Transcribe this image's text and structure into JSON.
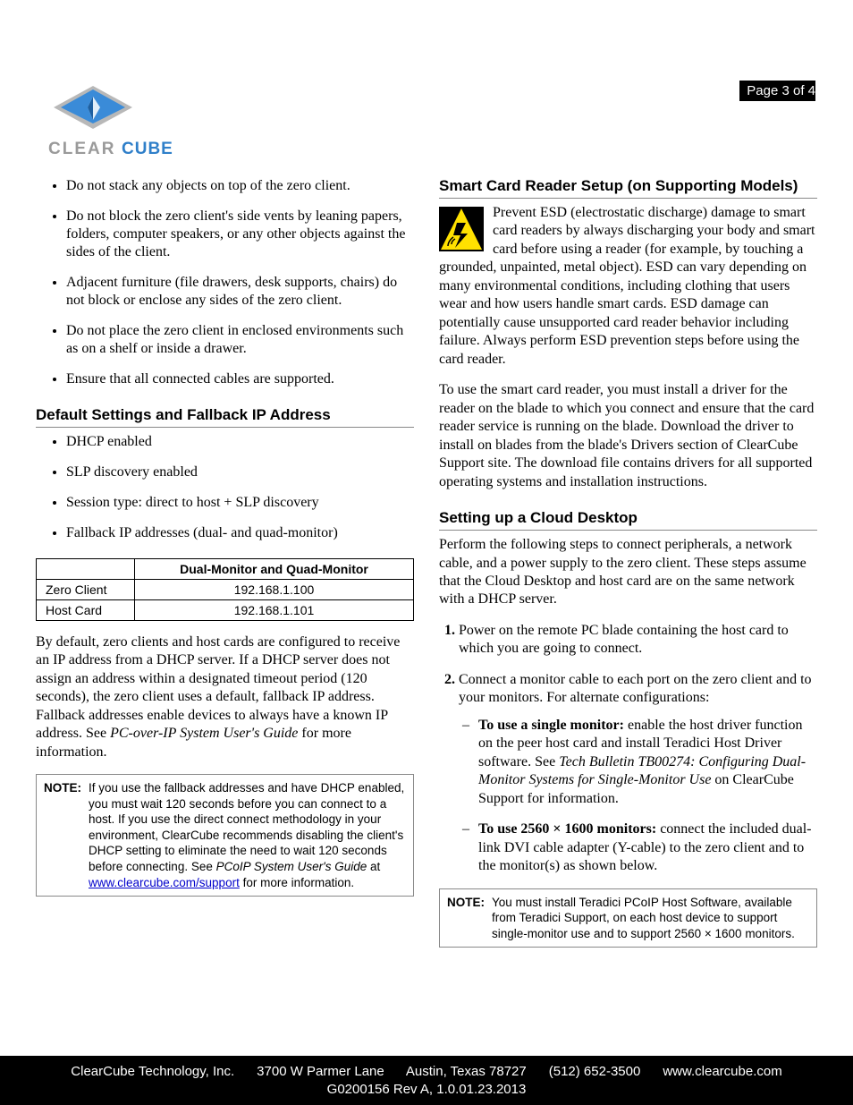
{
  "page_number": "Page 3 of 4",
  "logo": {
    "text1": "CLEAR",
    "text2": "CUBE"
  },
  "left": {
    "bullets": [
      "Do not stack any objects on top of the zero client.",
      "Do not block the zero client's side vents by leaning papers, folders, computer speakers, or any other objects against the sides of the client.",
      "Adjacent furniture (file drawers, desk supports, chairs) do not block or enclose any sides of the zero client.",
      "Do not place the zero client in enclosed environments such as on a shelf or inside a drawer.",
      "Ensure that all connected cables are supported."
    ],
    "section_defaults": "Default Settings and Fallback IP Address",
    "defaults_bullets": [
      "DHCP enabled",
      "SLP discovery enabled",
      "Session type: direct to host + SLP discovery",
      "Fallback IP addresses (dual- and quad-monitor)"
    ],
    "table": {
      "header_col2": "Dual-Monitor and Quad-Monitor",
      "rows": [
        {
          "label": "Zero Client",
          "value": "192.168.1.100"
        },
        {
          "label": "Host Card",
          "value": "192.168.1.101"
        }
      ]
    },
    "defaults_para_pre": "By default, zero clients and host cards are configured to receive an IP address from a DHCP server. If a DHCP server does not assign an address within a designated timeout period (120 seconds), the zero client uses a default, fallback IP address. Fallback addresses enable devices to always have a known IP address. See ",
    "defaults_para_italic": "PC-over-IP System User's Guide",
    "defaults_para_post": " for more information.",
    "note": {
      "label": "NOTE:",
      "text_pre": "If you use the fallback addresses and have DHCP enabled, you must wait 120 seconds before you can connect to a host. If you use the direct connect methodology in your environment, ClearCube recommends disabling the client's DHCP setting to eliminate the need to wait 120 seconds before connecting. See ",
      "text_italic": "PCoIP System User's Guide",
      "text_mid": " at ",
      "link": "www.clearcube.com/support",
      "text_post": " for more information."
    }
  },
  "right": {
    "section_smart": "Smart Card Reader Setup (on Supporting Models)",
    "esd_para": "Prevent ESD (electrostatic discharge) damage to smart card readers by always discharging your body and smart card before using a reader (for example, by touching a grounded, unpainted, metal object). ESD can vary depending on many environmental conditions, including clothing that users wear and how users handle smart cards. ESD damage can potentially cause unsupported card reader behavior including failure. Always perform ESD prevention steps before using the card reader.",
    "driver_para": "To use the smart card reader, you must install a driver for the reader on the blade to which you connect and ensure that the card reader service is running on the blade. Download the driver to install on blades from the blade's Drivers section of ClearCube Support site. The download file contains drivers for all supported operating systems and installation instructions.",
    "section_cloud": "Setting up a Cloud Desktop",
    "cloud_para": "Perform the following steps to connect peripherals, a network cable, and a power supply to the zero client. These steps assume that the Cloud Desktop and host card are on the same network with a DHCP server.",
    "steps": {
      "s1": "Power on the remote PC blade containing the host card to which you are going to connect.",
      "s2": "Connect a monitor cable to each port on the zero client and to your monitors. For alternate configurations:",
      "s2a_bold": "To use a single monitor:",
      "s2a_text": " enable the host driver function on the peer host card and install Teradici Host Driver software. See ",
      "s2a_italic": "Tech Bulletin TB00274: Configuring Dual-Monitor Systems for Single-Monitor Use",
      "s2a_post": " on ClearCube Support for information.",
      "s2b_bold": "To use 2560 × 1600 monitors:",
      "s2b_text": " connect the included dual-link DVI cable adapter (Y-cable) to the zero client and to the monitor(s) as shown below."
    },
    "note2": {
      "label": "NOTE:",
      "text": "You must install Teradici PCoIP Host Software, available from Teradici Support, on each host device to support single-monitor use and to support 2560 × 1600 monitors."
    }
  },
  "footer": {
    "line1": "ClearCube Technology, Inc.      3700 W Parmer Lane      Austin, Texas 78727      (512) 652-3500      www.clearcube.com",
    "line2": "G0200156 Rev A, 1.0.01.23.2013"
  }
}
